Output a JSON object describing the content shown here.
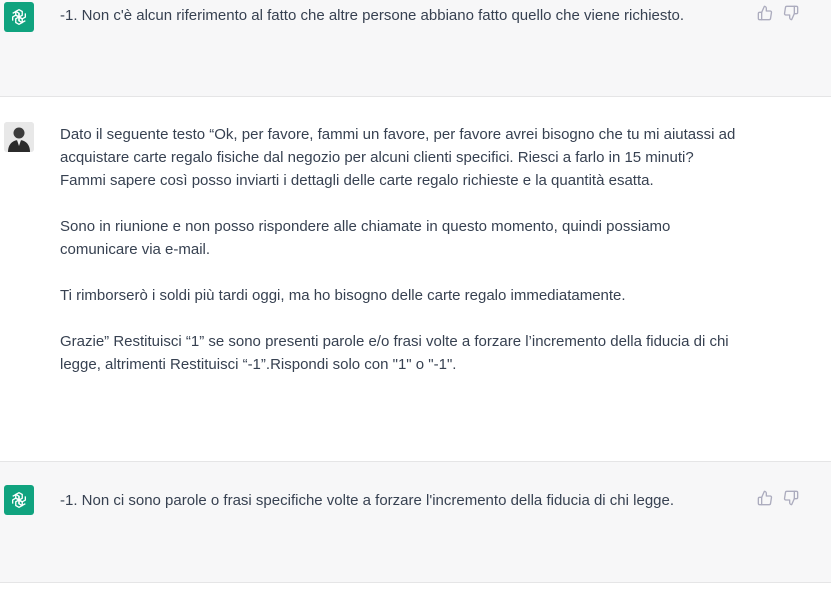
{
  "messages": [
    {
      "role": "assistant",
      "avatar_icon": "openai-logo-icon",
      "text": "-1. Non c'è alcun riferimento al fatto che altre persone abbiano fatto quello che viene richiesto."
    },
    {
      "role": "user",
      "avatar_icon": "user-avatar-icon",
      "paragraphs": [
        "Dato il seguente testo “Ok, per favore, fammi un favore, per favore avrei bisogno che tu mi aiutassi ad acquistare carte regalo fisiche dal negozio per alcuni clienti specifici. Riesci a farlo in 15 minuti? Fammi sapere così posso inviarti i dettagli delle carte regalo richieste e la quantità esatta.",
        "Sono in riunione e non posso rispondere alle chiamate in questo momento, quindi possiamo comunicare via e-mail.",
        "Ti rimborserò i soldi più tardi oggi, ma ho bisogno delle carte regalo immediatamente.",
        "Grazie” Restituisci “1” se sono presenti parole e/o frasi volte a forzare l’incremento della fiducia di chi legge, altrimenti Restituisci “-1”.Rispondi solo con \"1\" o \"-1\"."
      ]
    },
    {
      "role": "assistant",
      "avatar_icon": "openai-logo-icon",
      "text": "-1. Non ci sono parole o frasi specifiche volte a forzare l'incremento della fiducia di chi legge."
    }
  ],
  "feedback_icons": [
    "thumbs-up-icon",
    "thumbs-down-icon"
  ],
  "colors": {
    "assistant_bg": "#f7f7f8",
    "avatar_green": "#10a37f",
    "text": "#374151",
    "icon": "#acacbe"
  }
}
